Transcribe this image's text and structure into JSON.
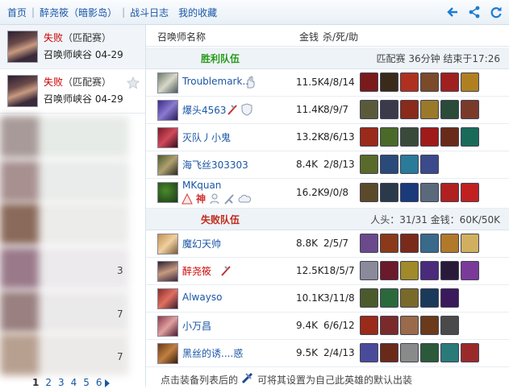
{
  "nav": {
    "home": "首页",
    "summoner": "醉尧筱（暗影岛）",
    "battle_log": "战斗日志",
    "favorites": "我的收藏"
  },
  "toolbar_icons": [
    "back-arrow-icon",
    "share-icon",
    "refresh-icon"
  ],
  "match_list": [
    {
      "result": "失败",
      "mode": "（匹配赛）",
      "map": "召唤师峡谷",
      "date": "04-29"
    },
    {
      "result": "失败",
      "mode": "（匹配赛）",
      "map": "召唤师峡谷",
      "date": "04-29"
    }
  ],
  "blurred_numbers": [
    "3",
    "7",
    "7"
  ],
  "pager": {
    "pages": [
      "1",
      "2",
      "3",
      "4",
      "5",
      "6"
    ],
    "current": "1"
  },
  "table_header": {
    "name": "召唤师名称",
    "gold": "金钱",
    "kda": "杀/死/助"
  },
  "win_team": {
    "label": "胜利队伍",
    "info": "匹配赛 36分钟 结束于17:26",
    "color": "#2a9a1a",
    "players": [
      {
        "name": "Troublemark..",
        "gold": "11.5K",
        "kda": "4/8/14"
      },
      {
        "name": "爆头4563",
        "gold": "11.4K",
        "kda": "8/9/7"
      },
      {
        "name": "灭队丿小鬼",
        "gold": "13.2K",
        "kda": "8/6/13"
      },
      {
        "name": "海飞丝303303",
        "gold": "8.4K",
        "kda": "2/8/13"
      },
      {
        "name": "MKquan",
        "gold": "16.2K",
        "kda": "9/0/8",
        "badge": "神"
      }
    ]
  },
  "lose_team": {
    "label": "失败队伍",
    "info": "人头：31/31 金钱：60K/50K",
    "color": "#c0281a",
    "players": [
      {
        "name": "魔幻天帅",
        "gold": "8.8K",
        "kda": "2/5/7"
      },
      {
        "name": "醉尧筱",
        "gold": "12.5K",
        "kda": "18/5/7"
      },
      {
        "name": "Alwayso",
        "gold": "10.1K",
        "kda": "3/11/8"
      },
      {
        "name": "小万昌",
        "gold": "9.4K",
        "kda": "6/6/12"
      },
      {
        "name": "黑丝的诱....惑",
        "gold": "9.5K",
        "kda": "2/4/13"
      }
    ]
  },
  "footer": {
    "before": "点击装备列表后的",
    "after": "可将其设置为自己此英雄的默认出装"
  },
  "colors": {
    "link": "#1a56a6",
    "loss": "#cc0000",
    "header_bg": "#eef3f8"
  }
}
